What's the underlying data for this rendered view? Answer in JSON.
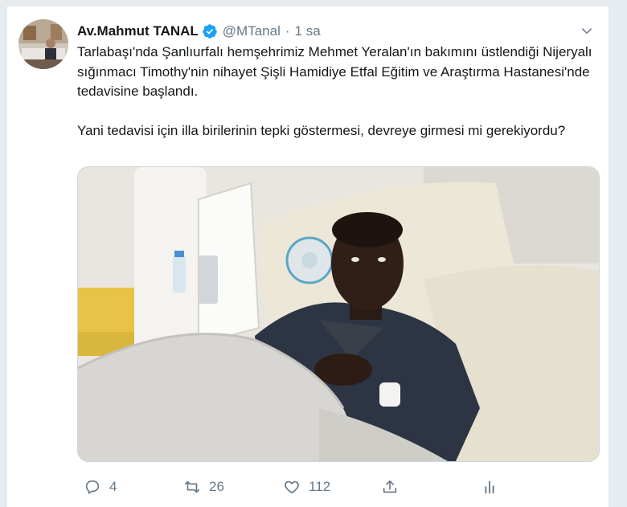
{
  "tweet": {
    "author_name": "Av.Mahmut TANAL",
    "handle": "@MTanal",
    "separator": "·",
    "time": "1 sa",
    "text": "Tarlabaşı'nda Şanlıurfalı hemşehrimiz Mehmet Yeralan'ın bakımını üstlendiği Nijeryalı sığınmacı Timothy'nin nihayet Şişli Hamidiye Etfal Eğitim ve Araştırma Hastanesi'nde tedavisine başlandı.\n\nYani tedavisi için illa birilerinin tepki göstermesi, devreye girmesi mi gerekiyordu?",
    "verified": true
  },
  "actions": {
    "reply_count": "4",
    "retweet_count": "26",
    "like_count": "112"
  },
  "colors": {
    "accent": "#1da1f2",
    "muted": "#657786",
    "text": "#14171a",
    "background": "#e6ecf0"
  },
  "icons": [
    "verified-badge-icon",
    "chevron-down-icon",
    "reply-icon",
    "retweet-icon",
    "like-icon",
    "share-icon",
    "analytics-icon"
  ]
}
